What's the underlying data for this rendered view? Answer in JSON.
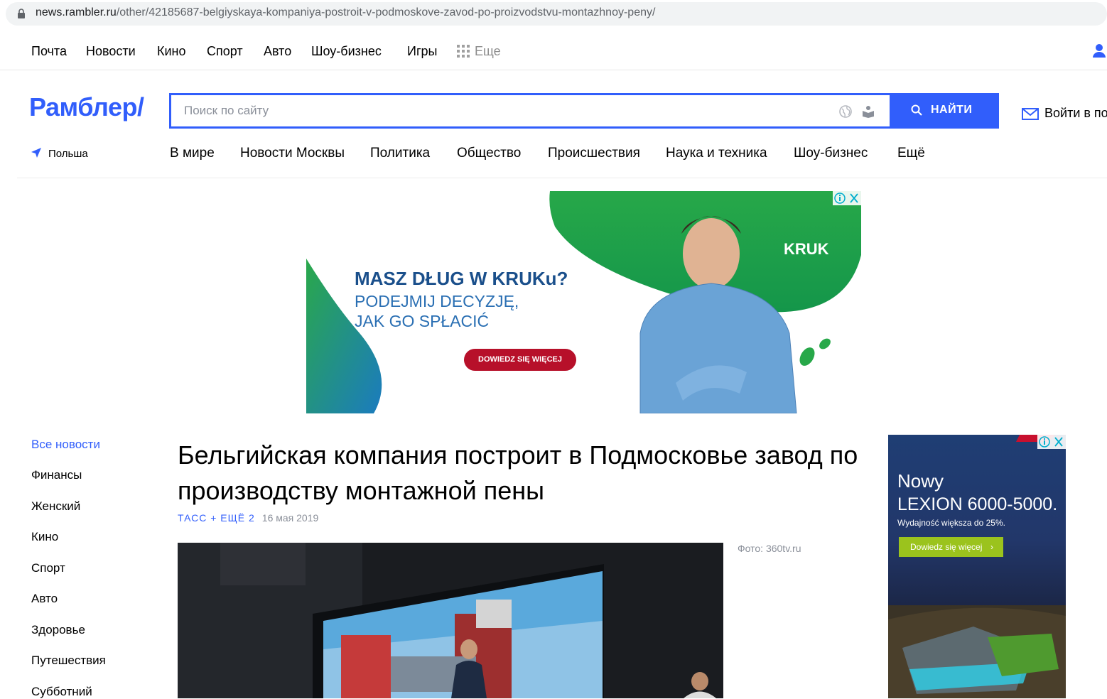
{
  "browser": {
    "url_host": "news.rambler.ru",
    "url_path": "/other/42185687-belgiyskaya-kompaniya-postroit-v-podmoskove-zavod-po-proizvodstvu-montazhnoy-peny/"
  },
  "topnav": {
    "items": [
      "Почта",
      "Новости",
      "Кино",
      "Спорт",
      "Авто",
      "Шоу-бизнес",
      "Игры"
    ],
    "more_label": "Еще"
  },
  "header": {
    "logo": "Рамблер/",
    "search_placeholder": "Поиск по сайту",
    "search_button": "НАЙТИ",
    "login_label": "Войти в по"
  },
  "secnav": {
    "geo_label": "Польша",
    "items": [
      "В мире",
      "Новости Москвы",
      "Политика",
      "Общество",
      "Происшествия",
      "Наука и техника",
      "Шоу-бизнес",
      "Ещё"
    ]
  },
  "ad_banner": {
    "headline": "MASZ DŁUG W KRUKu?",
    "sub1": "PODEJMIJ DECYZJĘ,",
    "sub2": "JAK GO SPŁACIĆ",
    "cta": "DOWIEDZ SIĘ WIĘCEJ",
    "brand": "KRUK"
  },
  "rubrics": [
    "Все новости",
    "Финансы",
    "Женский",
    "Кино",
    "Спорт",
    "Авто",
    "Здоровье",
    "Путешествия",
    "Субботний"
  ],
  "article": {
    "title": "Бельгийская компания построит в Подмосковье завод по производству монтажной пены",
    "source": "ТАСС + ЕЩЁ 2",
    "date": "16 мая 2019",
    "photo_credit": "Фото: 360tv.ru"
  },
  "side_ad": {
    "line1": "Nowy",
    "line2": "LEXION 6000-5000.",
    "line3": "Wydajność większa do 25%.",
    "cta": "Dowiedz się więcej"
  },
  "colors": {
    "accent": "#315efb",
    "ad_red": "#b7102a",
    "ad_green": "#2aa84a",
    "side_cta": "#9bc31d"
  }
}
